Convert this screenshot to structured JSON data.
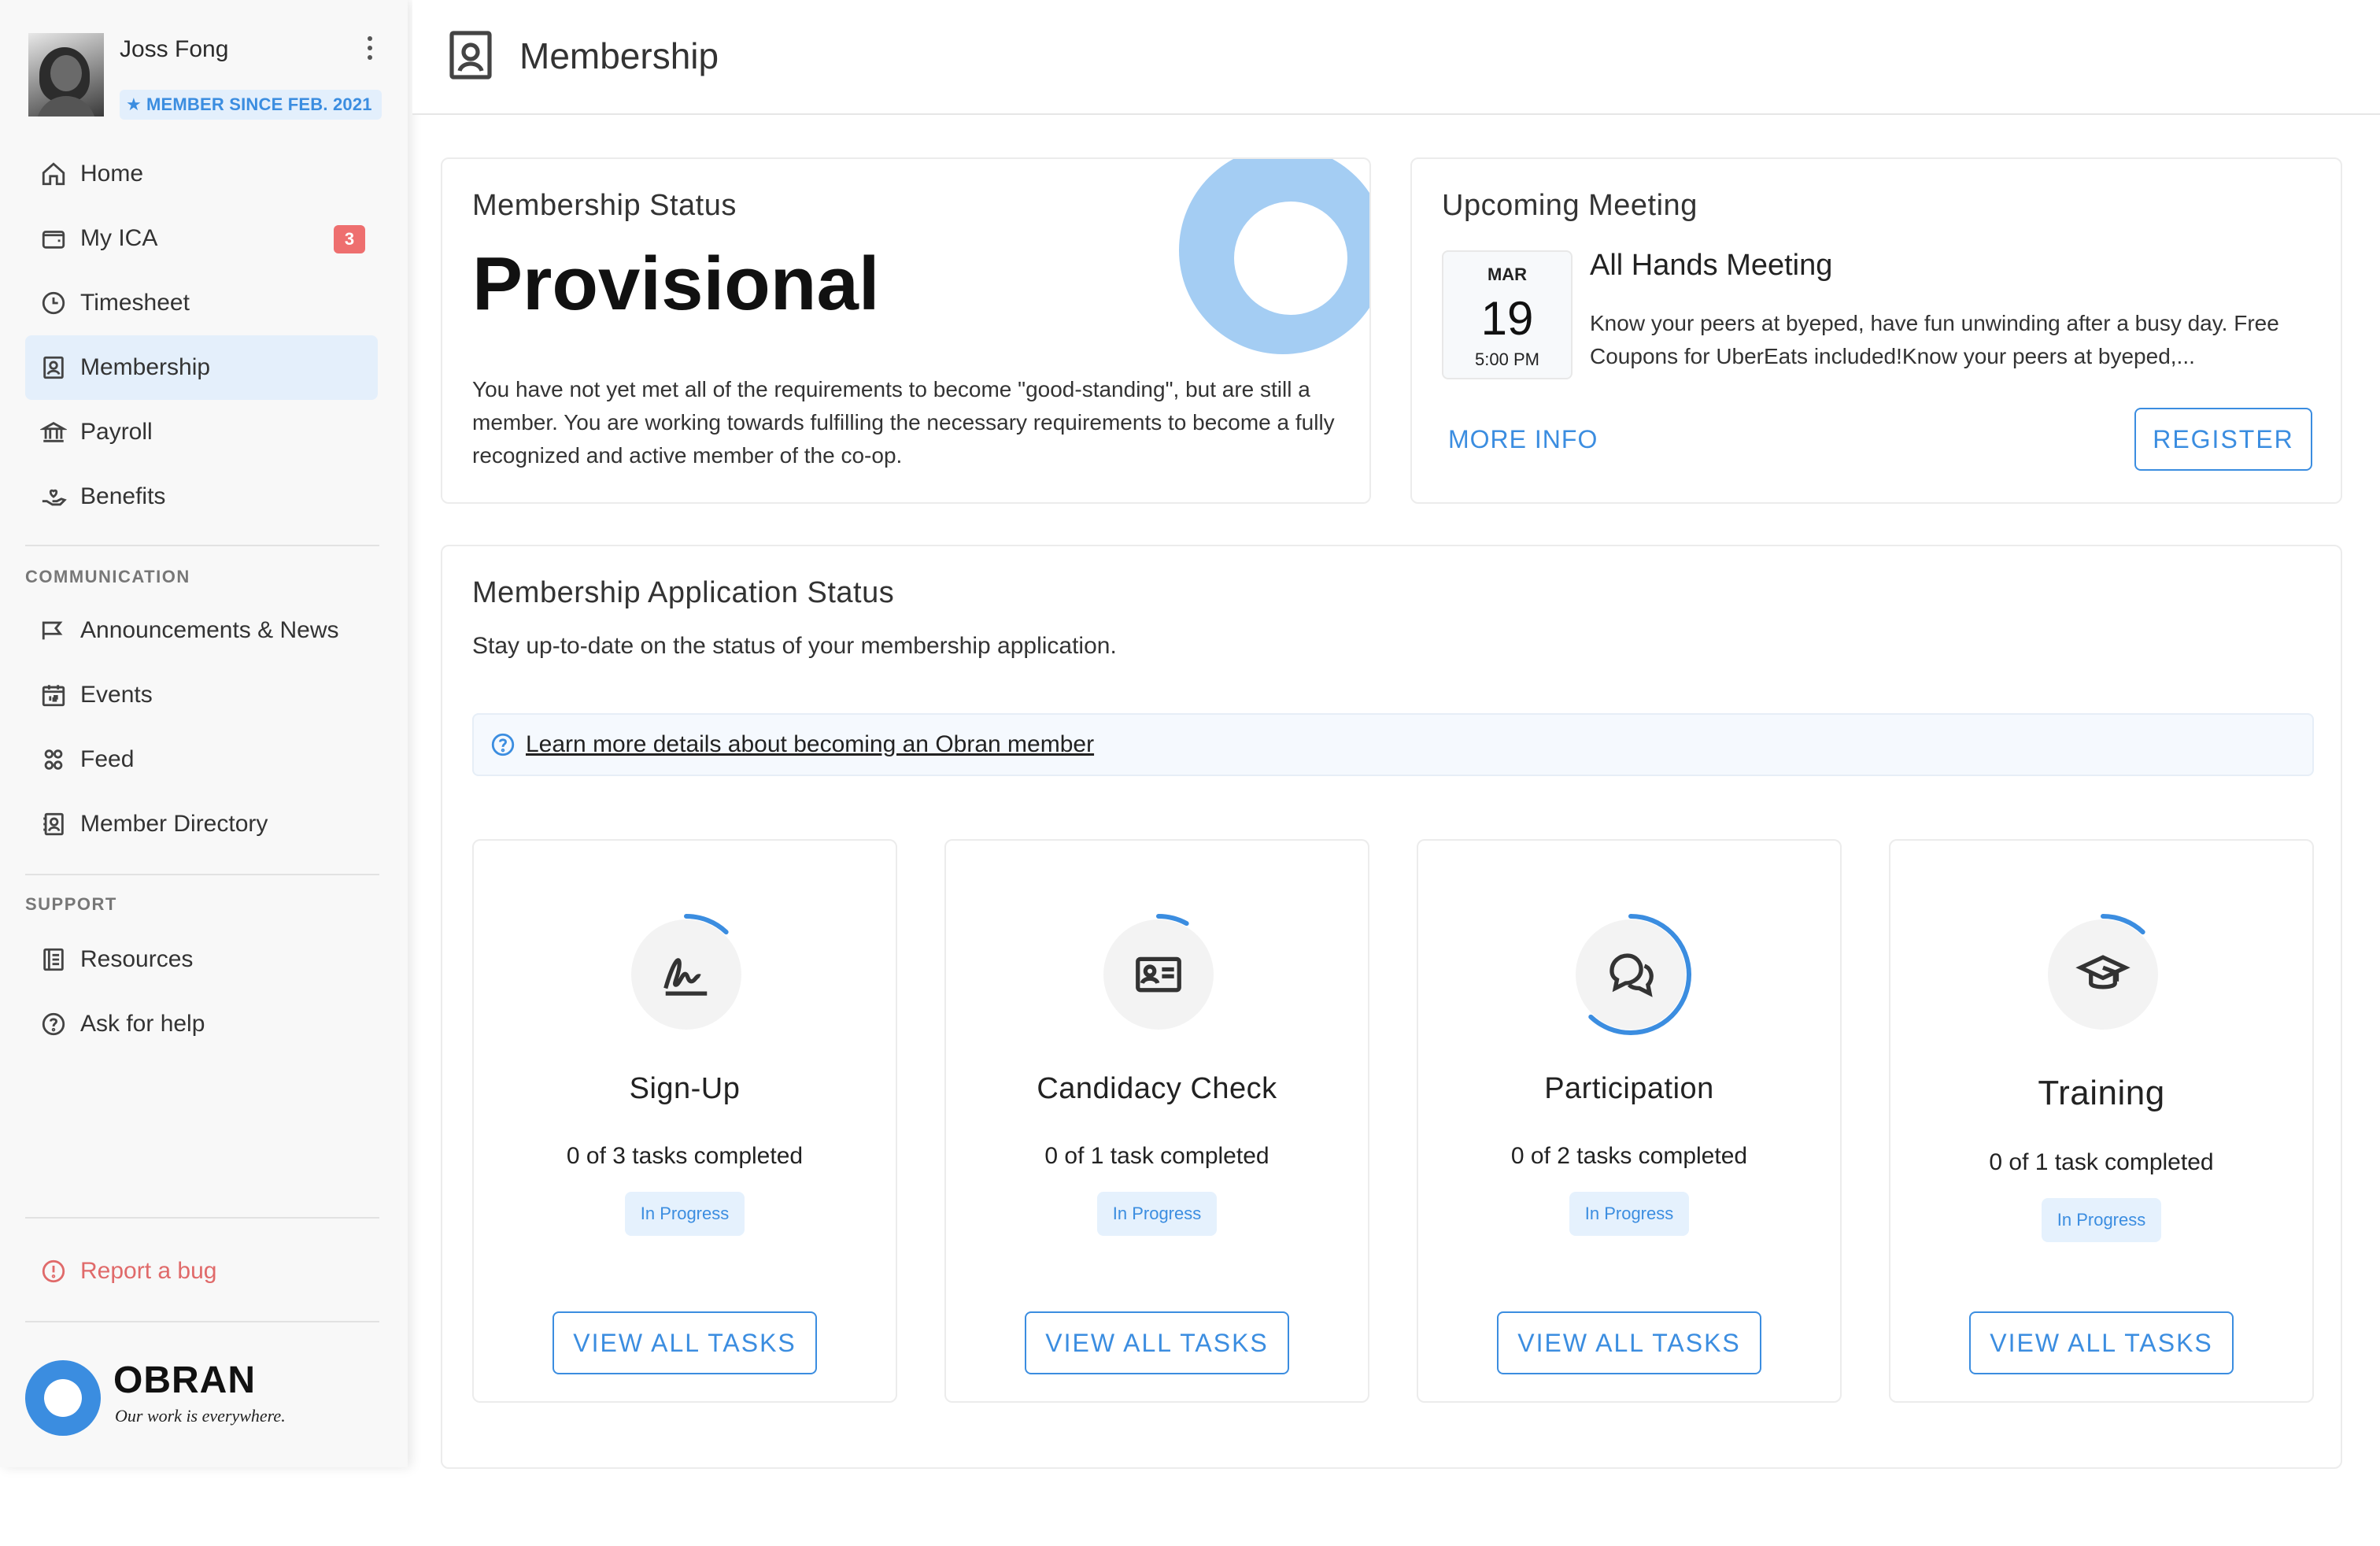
{
  "sidebar": {
    "user": {
      "name": "Joss Fong",
      "badge": "MEMBER SINCE FEB. 2021"
    },
    "nav_main": [
      {
        "label": "Home",
        "icon": "home-icon"
      },
      {
        "label": "My ICA",
        "icon": "wallet-icon",
        "count": "3"
      },
      {
        "label": "Timesheet",
        "icon": "clock-icon"
      },
      {
        "label": "Membership",
        "icon": "id-badge-icon",
        "active": true
      },
      {
        "label": "Payroll",
        "icon": "bank-icon"
      },
      {
        "label": "Benefits",
        "icon": "hand-heart-icon"
      }
    ],
    "communication": {
      "label": "COMMUNICATION",
      "items": [
        {
          "label": "Announcements & News",
          "icon": "megaphone-icon"
        },
        {
          "label": "Events",
          "icon": "calendar-icon"
        },
        {
          "label": "Feed",
          "icon": "people-icon"
        },
        {
          "label": "Member Directory",
          "icon": "contacts-icon"
        }
      ]
    },
    "support": {
      "label": "SUPPORT",
      "items": [
        {
          "label": "Resources",
          "icon": "book-icon"
        },
        {
          "label": "Ask for help",
          "icon": "question-icon"
        }
      ]
    },
    "report_bug": "Report a bug",
    "logo": {
      "name": "OBRAN",
      "tagline": "Our work is everywhere."
    }
  },
  "header": {
    "title": "Membership"
  },
  "status_card": {
    "title": "Membership Status",
    "value": "Provisional",
    "description": "You have not yet met all of the requirements to become \"good-standing\", but are still a member. You are working towards fulfilling the necessary requirements to become a fully recognized and active member of the co-op."
  },
  "meeting_card": {
    "title": "Upcoming Meeting",
    "month": "MAR",
    "day": "19",
    "time": "5:00 PM",
    "name": "All Hands Meeting",
    "description": "Know your peers at byeped, have fun unwinding after a busy day. Free Coupons for UberEats included!Know your peers at byeped,...",
    "more_info": "MORE INFO",
    "register": "REGISTER"
  },
  "application": {
    "title": "Membership Application Status",
    "subtitle": "Stay up-to-date on the status of your membership application.",
    "learn_more": "Learn more details about becoming an Obran member",
    "steps": [
      {
        "name": "Sign-Up",
        "tasks": "0 of 3 tasks completed",
        "status": "In Progress",
        "button": "VIEW ALL TASKS",
        "icon": "signature-icon",
        "progress": 0.12
      },
      {
        "name": "Candidacy Check",
        "tasks": "0 of 1 task completed",
        "status": "In Progress",
        "button": "VIEW ALL TASKS",
        "icon": "id-card-icon",
        "progress": 0.08
      },
      {
        "name": "Participation",
        "tasks": "0 of 2 tasks completed",
        "status": "In Progress",
        "button": "VIEW ALL TASKS",
        "icon": "chat-bubbles-icon",
        "progress": 0.62
      },
      {
        "name": "Training",
        "tasks": "0 of 1 task completed",
        "status": "In Progress",
        "button": "VIEW ALL TASKS",
        "icon": "graduation-cap-icon",
        "progress": 0.12
      }
    ]
  },
  "colors": {
    "accent": "#3b8de0",
    "accent_light": "#a4cdf3",
    "danger": "#ee6f6f"
  }
}
